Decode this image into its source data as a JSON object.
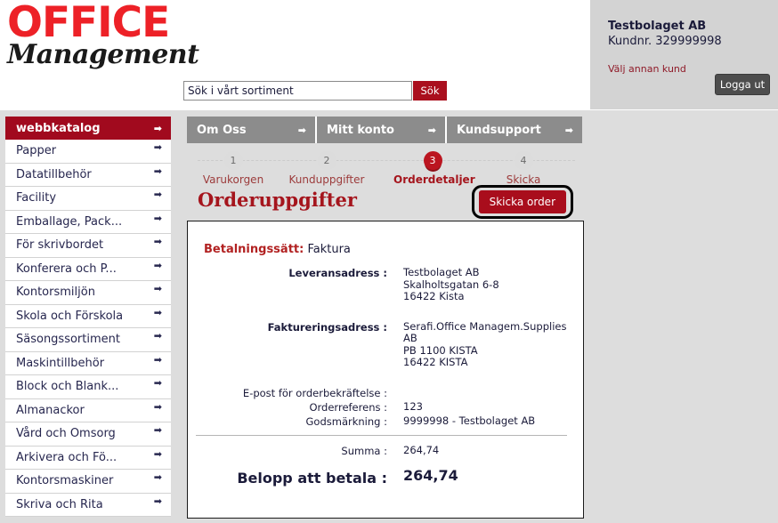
{
  "brand": {
    "line1": "OFFICE",
    "line2": "Management",
    "red": "#ed2127"
  },
  "customer": {
    "name": "Testbolaget AB",
    "number": "Kundnr. 329999998",
    "switch_link": "Välj annan kund",
    "logout_label": "Logga ut"
  },
  "search": {
    "value": "Sök i vårt sortiment",
    "button_label": "Sök"
  },
  "nav": {
    "tabs": [
      {
        "label": "Om Oss",
        "arrow": "➡",
        "width": 146
      },
      {
        "label": "Mitt konto",
        "arrow": "➡",
        "width": 146
      },
      {
        "label": "Kundsupport",
        "arrow": "➡",
        "width": 152
      }
    ]
  },
  "sidebar": {
    "header": {
      "label": "webbkatalog",
      "arrow": "➡"
    },
    "items": [
      {
        "label": "Papper",
        "arrow": "➡"
      },
      {
        "label": "Datatillbehör",
        "arrow": "➡"
      },
      {
        "label": "Facility",
        "arrow": "➡"
      },
      {
        "label": "Emballage, Pack...",
        "arrow": "➡"
      },
      {
        "label": "För skrivbordet",
        "arrow": "➡"
      },
      {
        "label": "Konferera och P...",
        "arrow": "➡"
      },
      {
        "label": "Kontorsmiljön",
        "arrow": "➡"
      },
      {
        "label": "Skola och Förskola",
        "arrow": "➡"
      },
      {
        "label": "Säsongssortiment",
        "arrow": "➡"
      },
      {
        "label": "Maskintillbehör",
        "arrow": "➡"
      },
      {
        "label": "Block och Blank...",
        "arrow": "➡"
      },
      {
        "label": "Almanackor",
        "arrow": "➡"
      },
      {
        "label": "Vård och Omsorg",
        "arrow": "➡"
      },
      {
        "label": "Arkivera och Fö...",
        "arrow": "➡"
      },
      {
        "label": "Kontorsmaskiner",
        "arrow": "➡"
      },
      {
        "label": "Skriva och Rita",
        "arrow": "➡"
      }
    ]
  },
  "checkout": {
    "steps": [
      {
        "number": "1",
        "label": "Varukorgen",
        "active": false
      },
      {
        "number": "2",
        "label": "Kunduppgifter",
        "active": false
      },
      {
        "number": "3",
        "label": "Orderdetaljer",
        "active": true
      },
      {
        "number": "4",
        "label": "Skicka",
        "active": false
      }
    ],
    "title": "Orderuppgifter",
    "send_order_label": "Skicka order",
    "highlight_color": "#000000"
  },
  "order": {
    "payment_label": "Betalningssätt:",
    "payment_value": "Faktura",
    "rows": [
      {
        "label": "Leveransadress :",
        "value": "Testbolaget AB\nSkalholtsgatan 6-8\n16422 Kista",
        "bold": true
      },
      {
        "label": "Faktureringsadress :",
        "value": "Serafi.Office Managem.Supplies\nAB\nPB 1100 KISTA\n16422 KISTA",
        "bold": true
      }
    ],
    "meta_rows": [
      {
        "label": "E-post för orderbekräftelse :",
        "value": ""
      },
      {
        "label": "Orderreferens :",
        "value": "123"
      },
      {
        "label": "Godsmärkning :",
        "value": "9999998 - Testbolaget AB"
      }
    ],
    "sum_label": "Summa :",
    "sum_value": "264,74",
    "total_label": "Belopp att betala :",
    "total_value": "264,74"
  }
}
